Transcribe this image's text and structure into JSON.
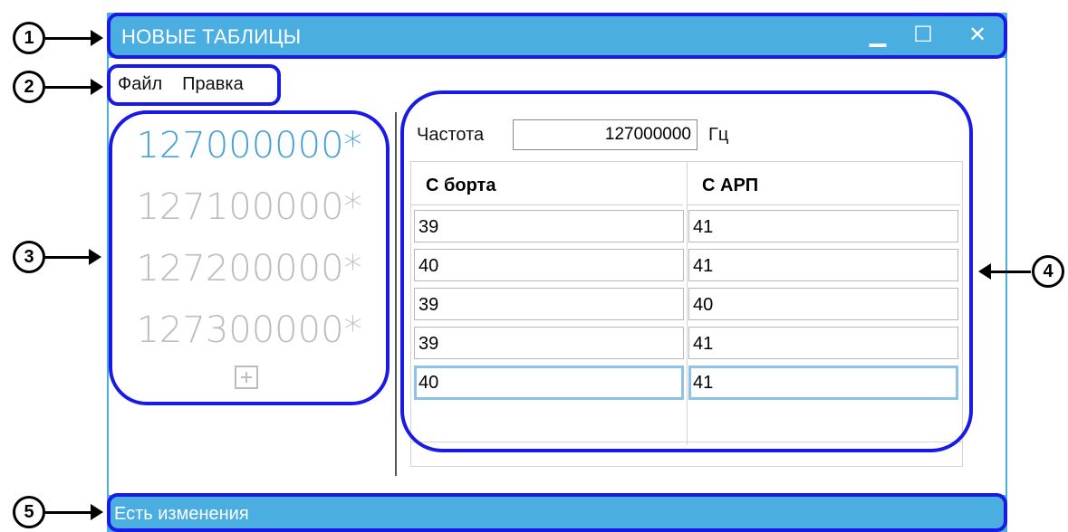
{
  "window": {
    "title": "НОВЫЕ ТАБЛИЦЫ",
    "minimize": "▁",
    "maximize": "☐",
    "close": "✕"
  },
  "menu": [
    "Файл",
    "Правка"
  ],
  "frequencies": [
    "127000000*",
    "127100000*",
    "127200000*",
    "127300000*"
  ],
  "editor": {
    "frequency_label": "Частота",
    "frequency_value": "127000000",
    "unit": "Гц",
    "columns": [
      "С борта",
      "С АРП"
    ],
    "rows": [
      [
        "39",
        "41"
      ],
      [
        "40",
        "41"
      ],
      [
        "39",
        "40"
      ],
      [
        "39",
        "41"
      ],
      [
        "40",
        "41"
      ]
    ]
  },
  "status": "Есть изменения",
  "callouts": [
    "1",
    "2",
    "3",
    "4",
    "5"
  ],
  "colors": {
    "accent": "#4aaee0",
    "active_freq": "#4aa2d4",
    "callout": "#1a1ae6"
  }
}
